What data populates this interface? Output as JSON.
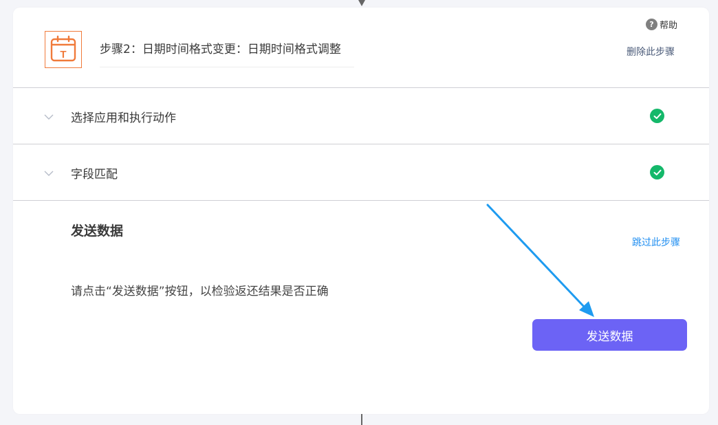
{
  "header": {
    "step_title": "步骤2：日期时间格式变更：日期时间格式调整",
    "help_label": "帮助",
    "help_icon_glyph": "?",
    "delete_step_label": "删除此步骤",
    "app_icon": "calendar-icon",
    "app_icon_letter": "T",
    "accent_color": "#f07a3a"
  },
  "sections": [
    {
      "label": "选择应用和执行动作",
      "status": "complete"
    },
    {
      "label": "字段匹配",
      "status": "complete"
    }
  ],
  "send_data": {
    "title": "发送数据",
    "skip_label": "跳过此步骤",
    "instruction": "请点击“发送数据”按钮，以检验返还结果是否正确",
    "button_label": "发送数据",
    "button_color": "#6c63f5"
  },
  "annotation": {
    "arrow_color": "#1e9bf0"
  },
  "colors": {
    "success": "#14b86a",
    "link": "#1f8ef1",
    "background": "#f4f5f9"
  }
}
